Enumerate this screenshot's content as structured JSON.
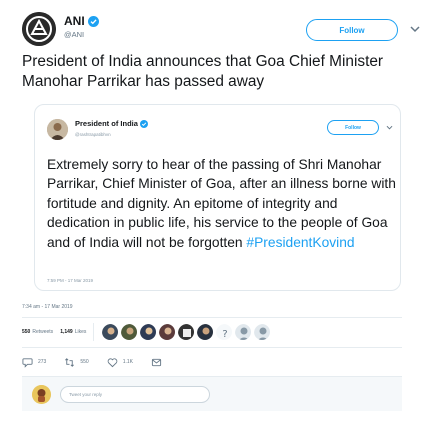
{
  "author": {
    "name": "ANI",
    "handle": "@ANI",
    "follow_label": "Follow"
  },
  "tweet": {
    "text": "President of India announces that Goa Chief Minister Manohar Parrikar has passed away"
  },
  "quoted": {
    "name": "President of India",
    "handle": "@rashtrapatibhvn",
    "follow_label": "Follow",
    "text_main": "Extremely sorry to hear of the passing of Shri Manohar Parrikar, Chief Minister of Goa, after an illness borne with fortitude and dignity. An epitome of integrity and dedication in public life, his service  to the people of Goa and of India will not be forgotten ",
    "hashtag": "#PresidentKovind",
    "time": "7:59 PM - 17 Mar 2019"
  },
  "meta": {
    "timestamp": "7:34 am - 17 Mar 2019"
  },
  "stats": {
    "retweets_count": "550",
    "retweets_label": "Retweets",
    "likes_count": "1,149",
    "likes_label": "Likes"
  },
  "actions": {
    "replies": "273",
    "retweets": "550",
    "likes": "1.1K"
  },
  "reply": {
    "placeholder": "Tweet your reply"
  },
  "colors": {
    "twitter_blue": "#1da1f2",
    "text_dark": "#14171a",
    "text_gray": "#657786"
  },
  "icons": [
    "ani-logo-icon",
    "verified-badge-icon",
    "chevron-down-icon",
    "reply-icon",
    "retweet-icon",
    "like-icon",
    "dm-icon"
  ]
}
